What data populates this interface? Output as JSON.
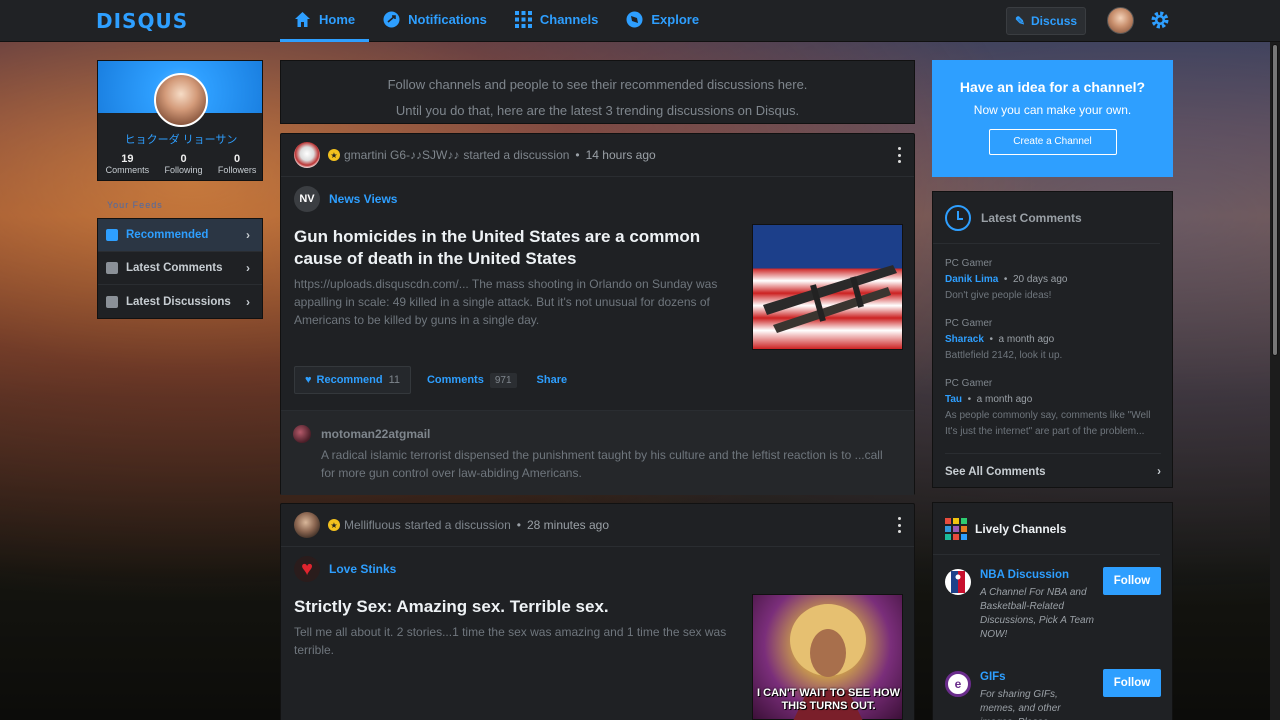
{
  "app": {
    "logo": "DISQUS",
    "accent": "#2e9fff"
  },
  "nav": [
    {
      "label": "Home",
      "icon": "home-icon",
      "active": true
    },
    {
      "label": "Notifications",
      "icon": "notifications-icon"
    },
    {
      "label": "Channels",
      "icon": "channels-grid-icon"
    },
    {
      "label": "Explore",
      "icon": "explore-compass-icon"
    }
  ],
  "topbar": {
    "discuss_label": "Discuss"
  },
  "profile": {
    "name": "ヒョクーダ リョーサン",
    "stats": [
      {
        "value": "19",
        "label": "Comments"
      },
      {
        "value": "0",
        "label": "Following"
      },
      {
        "value": "0",
        "label": "Followers"
      }
    ]
  },
  "sidebar": {
    "feeds_label": "Your Feeds",
    "items": [
      {
        "label": "Recommended",
        "active": true
      },
      {
        "label": "Latest Comments"
      },
      {
        "label": "Latest Discussions"
      }
    ]
  },
  "intro": {
    "line1": "Follow channels and people to see their recommended discussions here.",
    "line2": "Until you do that, here are the latest 3 trending discussions on Disqus."
  },
  "posts": [
    {
      "user": "gmartini G6-♪♪SJW♪♪",
      "action": "started a discussion",
      "time": "14 hours ago",
      "channel": "News Views",
      "channel_abbr": "NV",
      "title": "Gun homicides in the United States are a common cause of death in the United States",
      "excerpt": "https://uploads.disquscdn.com/... The mass shooting in Orlando on Sunday was appalling in scale: 49 killed in a single attack. But it's not unusual for dozens of Americans to be killed by guns in a single day.",
      "recommend_label": "Recommend",
      "recommend_count": "11",
      "comments_label": "Comments",
      "comments_count": "971",
      "share_label": "Share",
      "reply": {
        "user": "motoman22atgmail",
        "text": "A radical islamic terrorist dispensed the punishment taught by his culture and the leftist reaction is to ...call for more gun control over law-abiding Americans."
      }
    },
    {
      "user": "Mellifluous",
      "action": "started a discussion",
      "time": "28 minutes ago",
      "channel": "Love Stinks",
      "title": "Strictly Sex: Amazing sex. Terrible sex.",
      "excerpt": "Tell me all about it. 2 stories...1 time the sex was amazing and 1 time the sex was terrible.",
      "image_caption": "I CAN'T WAIT TO SEE HOW THIS TURNS OUT."
    }
  ],
  "idea": {
    "title": "Have an idea for a channel?",
    "subtitle": "Now you can make your own.",
    "button": "Create a Channel"
  },
  "latest_comments": {
    "title": "Latest Comments",
    "items": [
      {
        "forum": "PC Gamer",
        "user": "Danik Lima",
        "time": "20 days ago",
        "text": "Don't give people ideas!"
      },
      {
        "forum": "PC Gamer",
        "user": "Sharack",
        "time": "a month ago",
        "text": "Battlefield 2142, look it up."
      },
      {
        "forum": "PC Gamer",
        "user": "Tau",
        "time": "a month ago",
        "text": "As people commonly say, comments like \"Well It's just the internet\" are part of the problem..."
      }
    ],
    "see_all": "See All Comments"
  },
  "lively_channels": {
    "title": "Lively Channels",
    "items": [
      {
        "name": "NBA Discussion",
        "desc": "A Channel For NBA and Basketball-Related Discussions, Pick A Team NOW!",
        "follow": "Follow"
      },
      {
        "name": "GIFs",
        "desc": "For sharing GIFs, memes, and other images. Please",
        "follow": "Follow"
      }
    ]
  }
}
